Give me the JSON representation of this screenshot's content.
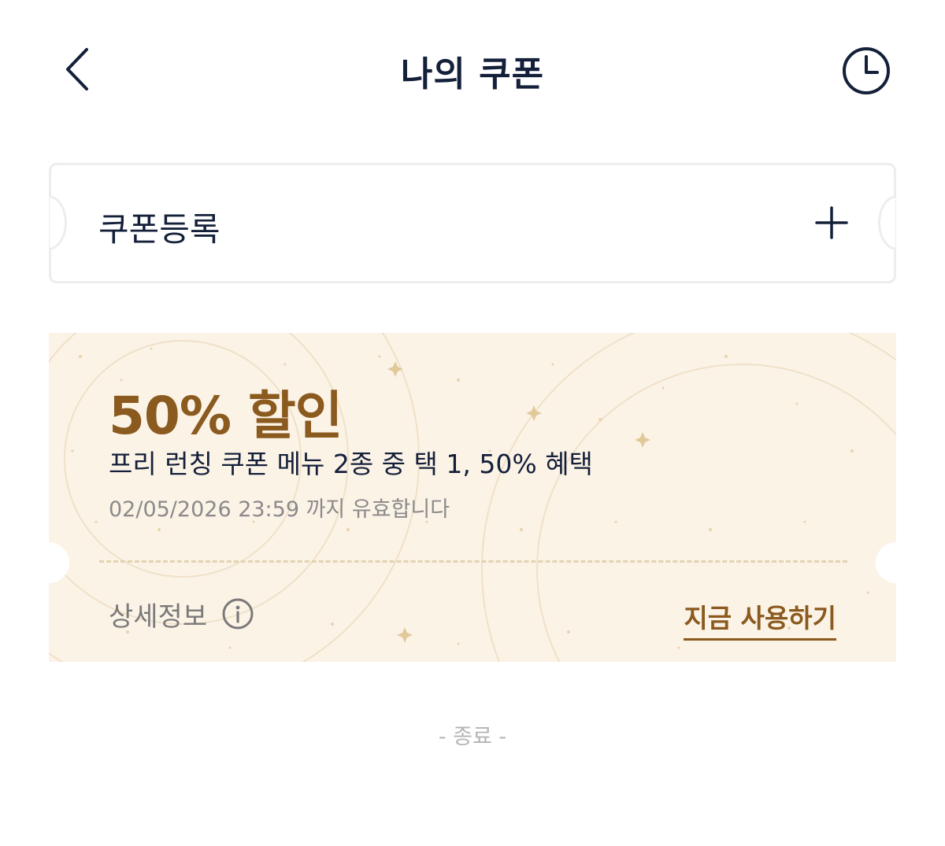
{
  "header": {
    "title": "나의 쿠폰",
    "back_icon": "chevron-left-icon",
    "history_icon": "clock-icon"
  },
  "register": {
    "label": "쿠폰등록",
    "action_icon": "plus-icon"
  },
  "coupons": [
    {
      "title": "50% 할인",
      "description": "프리 런칭 쿠폰 메뉴 2종 중 택 1, 50% 혜택",
      "expiry": "02/05/2026 23:59 까지 유효합니다",
      "detail_label": "상세정보",
      "detail_icon": "info-icon",
      "use_label": "지금 사용하기"
    }
  ],
  "list_end": "- 종료 -",
  "colors": {
    "navy": "#14203a",
    "gold": "#8a5a1e",
    "coupon_bg": "#fcf3e7",
    "border": "#ecedef"
  }
}
